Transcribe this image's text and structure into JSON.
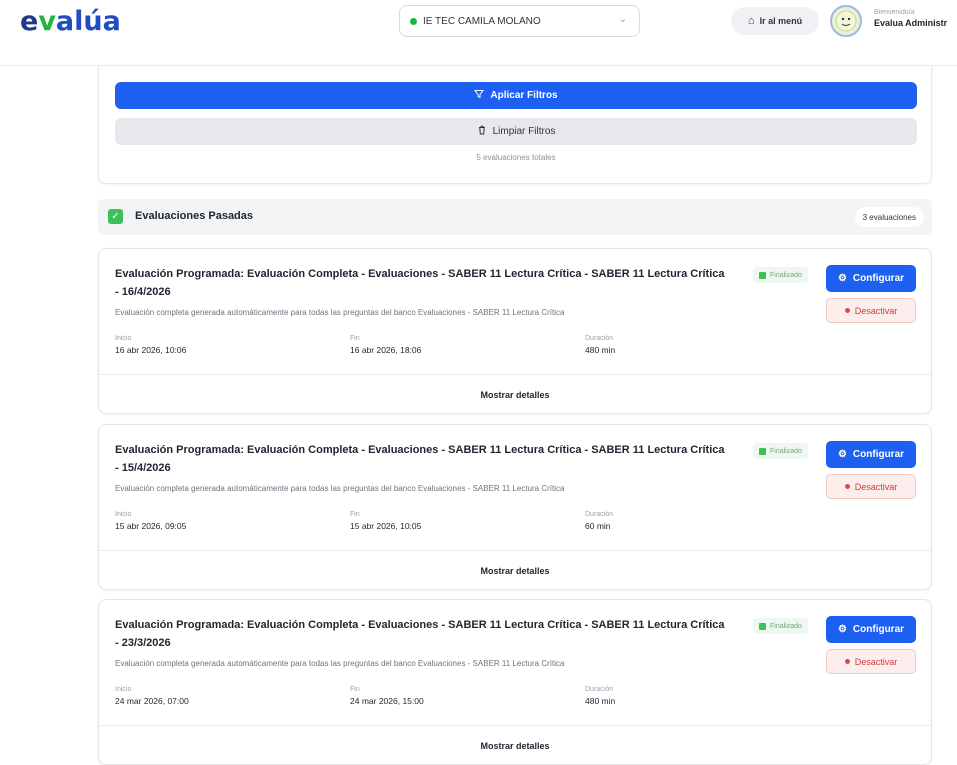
{
  "header": {
    "logo_e": "e",
    "logo_v": "v",
    "logo_rest": "alúa",
    "school_select": {
      "value": "IE TEC CAMILA MOLANO",
      "status_color": "#1fb34a"
    },
    "menu_button": {
      "icon": "home-icon",
      "label": "Ir al menú"
    },
    "user": {
      "greeting": "Bienvenido/a",
      "name": "Evalua Administr"
    }
  },
  "filters": {
    "apply_label": "Aplicar Filtros",
    "apply_icon": "filter-icon",
    "clear_label": "Limpiar Filtros",
    "clear_icon": "trash-icon",
    "total_text": "5 evaluaciones totales"
  },
  "section": {
    "title": "Evaluaciones Pasadas",
    "count": "3 evaluaciones",
    "icon": "check-square-icon"
  },
  "labels": {
    "start": "Inicio",
    "end": "Fin",
    "duration": "Duración",
    "status": "Finalizado",
    "configure": "Configurar",
    "deactivate": "Desactivar",
    "details": "Mostrar detalles"
  },
  "colors": {
    "primary": "#1d5ff0",
    "success": "#3fbf5a",
    "danger": "#d23b3b"
  },
  "evaluations": [
    {
      "title": "Evaluación Programada: Evaluación Completa - Evaluaciones - SABER 11 Lectura Crítica - SABER 11 Lectura Crítica - 16/4/2026",
      "description": "Evaluación completa generada automáticamente para todas las preguntas del banco Evaluaciones - SABER 11 Lectura Crítica",
      "start": "16 abr 2026, 10:06",
      "end": "16 abr 2026, 18:06",
      "duration": "480 min"
    },
    {
      "title": "Evaluación Programada: Evaluación Completa - Evaluaciones - SABER 11 Lectura Crítica - SABER 11 Lectura Crítica - 15/4/2026",
      "description": "Evaluación completa generada automáticamente para todas las preguntas del banco Evaluaciones - SABER 11 Lectura Crítica",
      "start": "15 abr 2026, 09:05",
      "end": "15 abr 2026, 10:05",
      "duration": "60 min"
    },
    {
      "title": "Evaluación Programada: Evaluación Completa - Evaluaciones - SABER 11 Lectura Crítica - SABER 11 Lectura Crítica - 23/3/2026",
      "description": "Evaluación completa generada automáticamente para todas las preguntas del banco Evaluaciones - SABER 11 Lectura Crítica",
      "start": "24 mar 2026, 07:00",
      "end": "24 mar 2026, 15:00",
      "duration": "480 min"
    }
  ]
}
